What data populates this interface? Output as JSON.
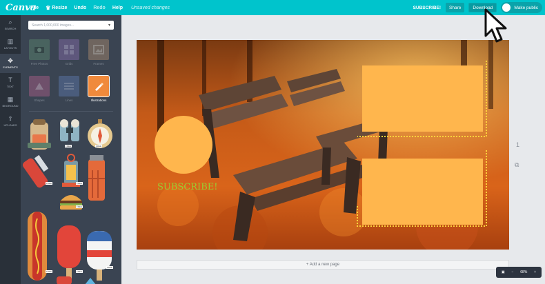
{
  "app": {
    "logo": "Canva"
  },
  "menu": {
    "file": "File",
    "resize": "Resize",
    "undo": "Undo",
    "redo": "Redo",
    "help": "Help",
    "status": "Unsaved changes"
  },
  "topbar_right": {
    "subscribe": "SUBSCRIBE!",
    "share": "Share",
    "download": "Download",
    "make_public": "Make public"
  },
  "rail": [
    {
      "label": "SEARCH",
      "icon": "search-icon"
    },
    {
      "label": "LAYOUTS",
      "icon": "layouts-icon"
    },
    {
      "label": "ELEMENTS",
      "icon": "elements-icon"
    },
    {
      "label": "TEXT",
      "icon": "text-icon"
    },
    {
      "label": "BKGROUND",
      "icon": "background-icon"
    },
    {
      "label": "UPLOADS",
      "icon": "uploads-icon"
    }
  ],
  "panel": {
    "search_placeholder": "Search 1,000,000 images...",
    "categories": [
      "Free Photos",
      "Grids",
      "Frames",
      "Shapes",
      "Lines",
      "Illustrations"
    ],
    "free_badge": "FREE"
  },
  "design": {
    "text": "SUBSCRIBE!"
  },
  "canvas": {
    "page_number": "1",
    "add_page": "+ Add a new page"
  },
  "zoom": {
    "level": "68%"
  },
  "colors": {
    "brand": "#00c4cc",
    "panel": "#3a4452",
    "shape": "#ffb64d",
    "text_green": "#9acd32"
  }
}
